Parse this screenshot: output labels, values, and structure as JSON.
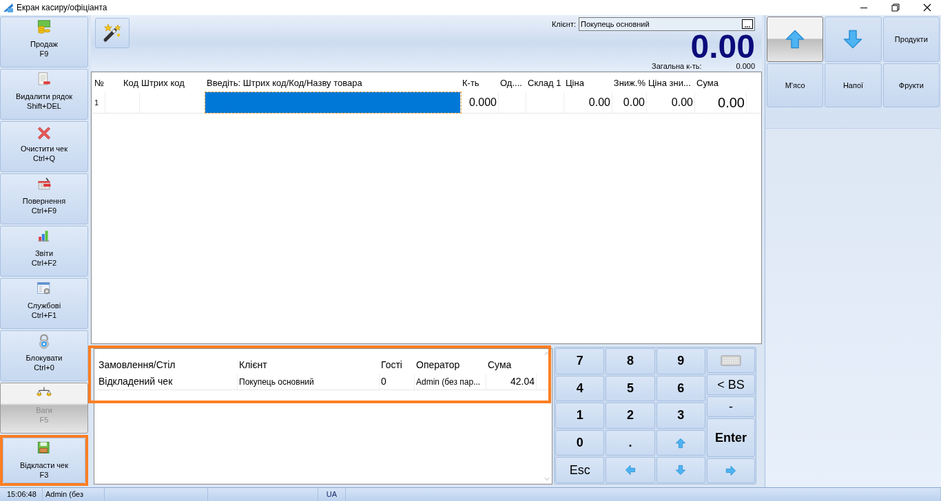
{
  "window": {
    "title": "Екран касиру/офіціанта"
  },
  "sidebar": {
    "items": [
      {
        "label": "Продаж",
        "shortcut": "F9",
        "highlighted": false,
        "outlined": false
      },
      {
        "label": "Видалити рядок",
        "shortcut": "Shift+DEL",
        "highlighted": false,
        "outlined": false
      },
      {
        "label": "Очистити чек",
        "shortcut": "Ctrl+Q",
        "highlighted": false,
        "outlined": false
      },
      {
        "label": "Повернення",
        "shortcut": "Ctrl+F9",
        "highlighted": false,
        "outlined": false
      },
      {
        "label": "Звіти",
        "shortcut": "Ctrl+F2",
        "highlighted": false,
        "outlined": false
      },
      {
        "label": "Службові",
        "shortcut": "Ctrl+F1",
        "highlighted": false,
        "outlined": false
      },
      {
        "label": "Блокувати",
        "shortcut": "Ctrl+0",
        "highlighted": false,
        "outlined": false
      },
      {
        "label": "Ваги",
        "shortcut": "F5",
        "highlighted": true,
        "outlined": false
      },
      {
        "label": "Відкласти чек",
        "shortcut": "F3",
        "highlighted": false,
        "outlined": true
      }
    ]
  },
  "header": {
    "client_label": "Клієнт:",
    "client_value": "Покупець основний",
    "client_button": "...",
    "total": "0.00",
    "total_qty_label": "Загальна к-ть:",
    "total_qty": "0.000"
  },
  "table": {
    "columns": [
      {
        "label": "№"
      },
      {
        "label": "Код"
      },
      {
        "label": "Штрих код"
      },
      {
        "label": "Введіть: Штрих код/Код/Назву товара"
      },
      {
        "label": "К-ть"
      },
      {
        "label": "Од...."
      },
      {
        "label": "Склад 1"
      },
      {
        "label": "Ціна"
      },
      {
        "label": "Зниж.%"
      },
      {
        "label": "Ціна зни..."
      },
      {
        "label": "Сума"
      }
    ],
    "rows": [
      {
        "no": "1",
        "quantity": "0.000",
        "price": "0.00",
        "discount": "0.00",
        "discounted_price": "0.00",
        "sum": "0.00",
        "input_selected": true
      }
    ]
  },
  "deferred": {
    "outlined": true,
    "columns": [
      {
        "label": "Замовлення/Стіл"
      },
      {
        "label": "Клієнт"
      },
      {
        "label": "Гості"
      },
      {
        "label": "Оператор"
      },
      {
        "label": "Сума"
      }
    ],
    "rows": [
      {
        "cells": [
          "Відкладений чек",
          "Покупець основний",
          "0",
          "Admin (без пар...",
          "42.04"
        ]
      }
    ]
  },
  "keypad": {
    "grid": [
      {
        "kind": "text",
        "label": "7"
      },
      {
        "kind": "text",
        "label": "8"
      },
      {
        "kind": "text",
        "label": "9"
      },
      {
        "kind": "text",
        "label": "4"
      },
      {
        "kind": "text",
        "label": "5"
      },
      {
        "kind": "text",
        "label": "6"
      },
      {
        "kind": "text",
        "label": "1"
      },
      {
        "kind": "text",
        "label": "2"
      },
      {
        "kind": "text",
        "label": "3"
      },
      {
        "kind": "text",
        "label": "0"
      },
      {
        "kind": "text",
        "label": "."
      },
      {
        "kind": "up"
      },
      {
        "kind": "text",
        "label": "Esc",
        "plain": true
      },
      {
        "kind": "left"
      },
      {
        "kind": "down"
      }
    ],
    "side": [
      {
        "kind": "keyboard"
      },
      {
        "kind": "text",
        "label": "< BS",
        "plain": true
      },
      {
        "kind": "text",
        "label": "-",
        "plain": true
      },
      {
        "kind": "text",
        "label": "Enter"
      },
      {
        "kind": "right"
      }
    ]
  },
  "categories": {
    "items": [
      {
        "kind": "up",
        "highlighted": true
      },
      {
        "kind": "down",
        "highlighted": false
      },
      {
        "kind": "text",
        "label": "Продукти",
        "highlighted": false
      },
      {
        "kind": "text",
        "label": "М'ясо",
        "highlighted": false
      },
      {
        "kind": "text",
        "label": "Напої",
        "highlighted": false
      },
      {
        "kind": "text",
        "label": "Фрукти",
        "highlighted": false
      }
    ]
  },
  "status_bar": {
    "time": "15:06:48",
    "user": "Admin (без",
    "language": "UA"
  }
}
